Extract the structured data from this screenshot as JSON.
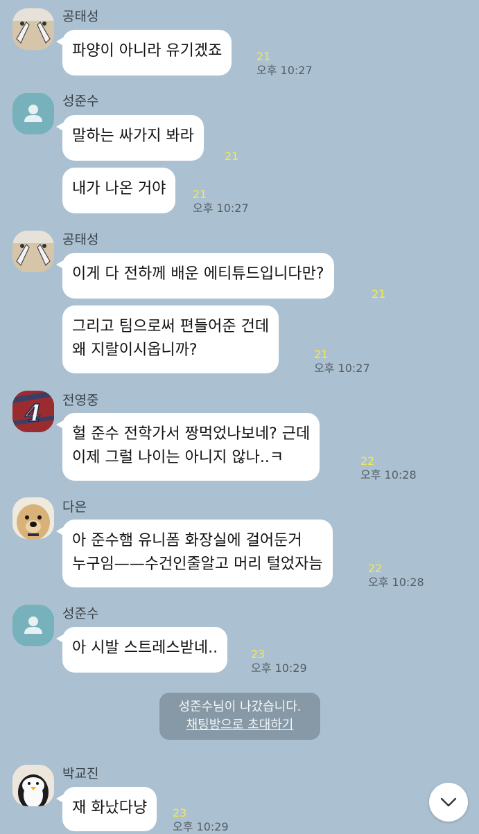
{
  "messages": [
    {
      "sender": "공태성",
      "text": "파양이 아니라 유기겠죠",
      "unread": "21",
      "time": "오후 10:27"
    },
    {
      "sender": "성준수",
      "text": "말하는 싸가지 봐라",
      "unread": "21"
    },
    {
      "text": "내가 나온 거야",
      "unread": "21",
      "time": "오후 10:27"
    },
    {
      "sender": "공태성",
      "text": "이게 다 전하께 배운 에티튜드입니다만?",
      "unread": "21"
    },
    {
      "text_lines": [
        "그리고 팀으로써 편들어준 건데",
        "왜 지랄이시옵니까?"
      ],
      "unread": "21",
      "time": "오후 10:27"
    },
    {
      "sender": "전영중",
      "text_lines": [
        "헐 준수 전학가서 짱먹었나보네? 근데",
        "이제 그럴 나이는 아니지 않나..ㅋ"
      ],
      "unread": "22",
      "time": "오후 10:28"
    },
    {
      "sender": "다은",
      "text_lines": [
        "아 준수햄 유니폼 화장실에 걸어둔거",
        "누구임——수건인줄알고 머리 털었자늠"
      ],
      "unread": "22",
      "time": "오후 10:28"
    },
    {
      "sender": "성준수",
      "text": "아 시발 스트레스받네..",
      "unread": "23",
      "time": "오후 10:29"
    },
    {
      "sender": "박교진",
      "text": "재 화났다냥",
      "unread": "23",
      "time": "오후 10:29"
    }
  ],
  "system_notice": {
    "text": "성준수님이 나갔습니다.",
    "link": "채팅방으로 초대하기"
  },
  "icons": {
    "scroll_down": "chevron-down-icon",
    "default_avatar": "person-icon"
  }
}
